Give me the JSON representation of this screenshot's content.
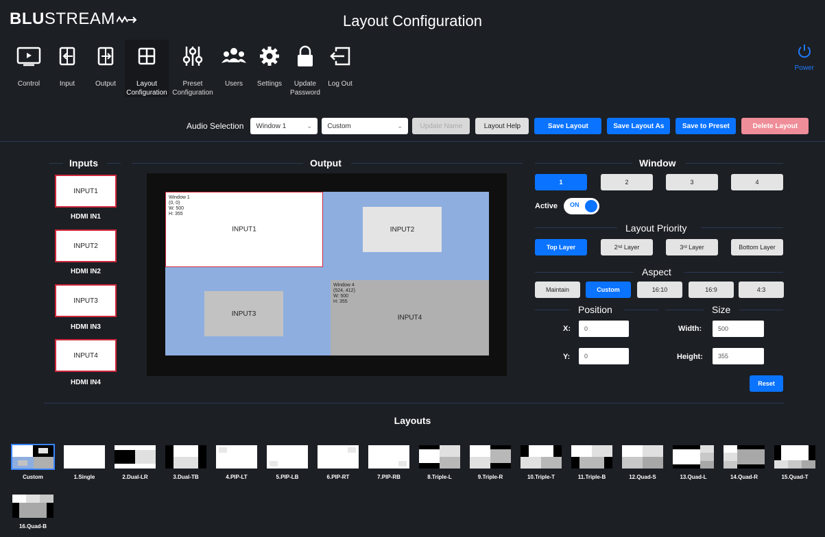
{
  "header": {
    "logo_bold": "BLU",
    "logo_rest": "STREAM",
    "title": "Layout Configuration"
  },
  "nav": [
    {
      "label": "Control",
      "icon": "monitor-play-icon"
    },
    {
      "label": "Input",
      "icon": "input-icon"
    },
    {
      "label": "Output",
      "icon": "output-icon"
    },
    {
      "label": "Layout\nConfiguration",
      "icon": "grid-icon"
    },
    {
      "label": "Preset\nConfiguration",
      "icon": "sliders-icon"
    },
    {
      "label": "Users",
      "icon": "users-icon"
    },
    {
      "label": "Settings",
      "icon": "gear-icon"
    },
    {
      "label": "Update\nPassword",
      "icon": "lock-icon"
    },
    {
      "label": "Log Out",
      "icon": "logout-icon"
    }
  ],
  "power_label": "Power",
  "toolbar": {
    "audio_label": "Audio Selection",
    "audio_value": "Window 1",
    "layout_value": "Custom",
    "update_name": "Update Name",
    "layout_help": "Layout Help",
    "save_layout": "Save Layout",
    "save_layout_as": "Save Layout As",
    "save_to_preset": "Save to Preset",
    "delete_layout": "Delete Layout"
  },
  "sections": {
    "inputs": "Inputs",
    "output": "Output",
    "window": "Window",
    "layout_priority": "Layout Priority",
    "aspect": "Aspect",
    "position": "Position",
    "size": "Size",
    "layouts": "Layouts"
  },
  "inputs": [
    {
      "name": "INPUT1",
      "label": "HDMI IN1"
    },
    {
      "name": "INPUT2",
      "label": "HDMI IN2"
    },
    {
      "name": "INPUT3",
      "label": "HDMI IN3"
    },
    {
      "name": "INPUT4",
      "label": "HDMI IN4"
    }
  ],
  "output": {
    "window1": {
      "meta": "Window 1\n(0, 0)\nW: 500\nH: 355",
      "label": "INPUT1"
    },
    "input2": "INPUT2",
    "input3": "INPUT3",
    "window4": {
      "meta": "Window 4\n(524, 412)\nW: 500\nH: 355",
      "label": "INPUT4"
    }
  },
  "window_buttons": [
    "1",
    "2",
    "3",
    "4"
  ],
  "active_label": "Active",
  "toggle_label": "ON",
  "priority": {
    "top": "Top Layer",
    "second_num": "2",
    "second_sup": "nd",
    "third_num": "3",
    "third_sup": "rd",
    "layer_word": " Layer",
    "bottom": "Bottom Layer"
  },
  "aspect_buttons": [
    "Maintain",
    "Custom",
    "16:10",
    "16:9",
    "4:3"
  ],
  "position": {
    "x_label": "X:",
    "x_value": "0",
    "y_label": "Y:",
    "y_value": "0"
  },
  "size": {
    "w_label": "Width:",
    "w_value": "500",
    "h_label": "Height:",
    "h_value": "355"
  },
  "reset_label": "Reset",
  "layouts": [
    "Custom",
    "1.Single",
    "2.Dual-LR",
    "3.Dual-TB",
    "4.PIP-LT",
    "5.PIP-LB",
    "6.PIP-RT",
    "7.PIP-RB",
    "8.Triple-L",
    "9.Triple-R",
    "10.Triple-T",
    "11.Triple-B",
    "12.Quad-S",
    "13.Quad-L",
    "14.Quad-R",
    "15.Quad-T",
    "16.Quad-B"
  ],
  "colors": {
    "accent": "#0a73ff",
    "delete": "#ef8d98",
    "canvas": "#8eaee0",
    "input_border": "#d0273b"
  }
}
